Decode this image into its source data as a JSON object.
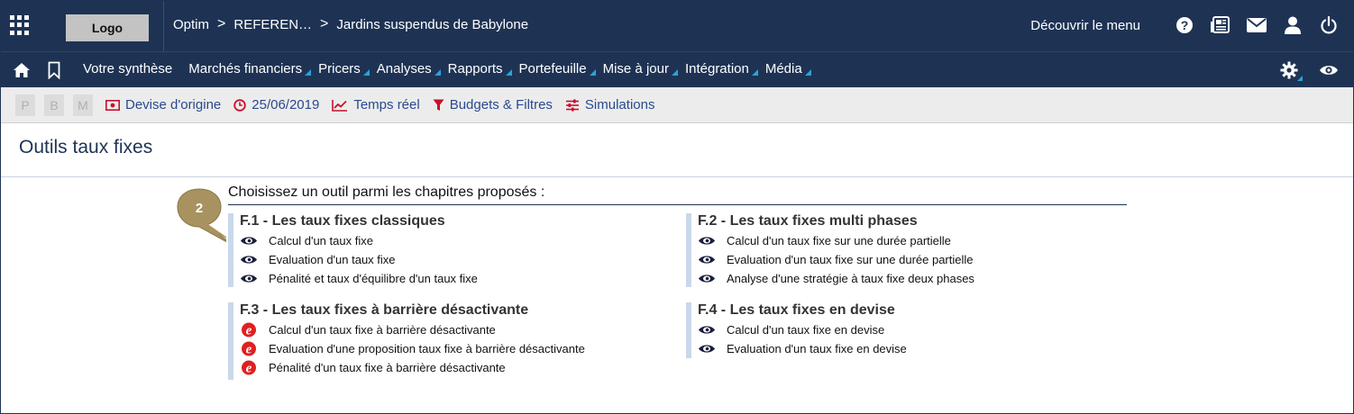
{
  "header": {
    "logo": "Logo",
    "breadcrumb": [
      "Optim",
      "REFEREN…",
      "Jardins suspendus de Babylone"
    ],
    "discover_menu": "Découvrir le menu",
    "icons": [
      "apps-grid-icon",
      "help-icon",
      "newspaper-icon",
      "mail-icon",
      "user-icon",
      "power-icon"
    ]
  },
  "nav": {
    "icons": [
      "home-icon",
      "bookmark-icon"
    ],
    "items": [
      "Votre synthèse",
      "Marchés financiers",
      "Pricers",
      "Analyses",
      "Rapports",
      "Portefeuille",
      "Mise à jour",
      "Intégration",
      "Média"
    ],
    "right_icons": [
      "settings-icon",
      "eye-icon"
    ],
    "accent_color": "#29a3d8",
    "bar_color": "#1e3354"
  },
  "toolbar": {
    "pbm": [
      "P",
      "B",
      "M"
    ],
    "currency": "Devise d'origine",
    "date": "25/06/2019",
    "realtime": "Temps réel",
    "budgets": "Budgets & Filtres",
    "simulations": "Simulations",
    "link_color": "#2a4a8e"
  },
  "page": {
    "title": "Outils taux fixes",
    "intro": "Choisissez un outil parmi les chapitres proposés :",
    "badge": "2"
  },
  "sections": [
    {
      "title": "F.1 - Les taux fixes classiques",
      "icon": "eye-bullet-icon",
      "items": [
        "Calcul d'un taux fixe",
        "Evaluation d'un taux fixe",
        "Pénalité et taux d'équilibre d'un taux fixe"
      ]
    },
    {
      "title": "F.2 - Les taux fixes multi phases",
      "icon": "eye-bullet-icon",
      "items": [
        "Calcul d'un taux fixe sur une durée partielle",
        "Evaluation d'un taux fixe sur une durée partielle",
        "Analyse d'une stratégie à taux fixe deux phases"
      ]
    },
    {
      "title": "F.3 - Les taux fixes à barrière désactivante",
      "icon": "e-badge-icon",
      "items": [
        "Calcul d'un taux fixe à barrière désactivante",
        "Evaluation d'une proposition taux fixe à barrière désactivante",
        "Pénalité d'un taux fixe à barrière désactivante"
      ]
    },
    {
      "title": "F.4 - Les taux fixes en devise",
      "icon": "eye-bullet-icon",
      "items": [
        "Calcul d'un taux fixe en devise",
        "Evaluation d'un taux fixe en devise"
      ]
    }
  ]
}
